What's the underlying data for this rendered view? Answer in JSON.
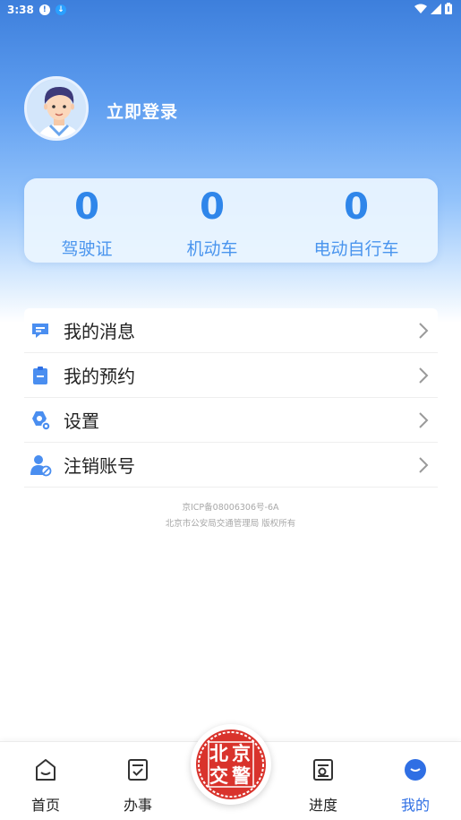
{
  "status_bar": {
    "time": "3:38",
    "left_icons": [
      "alert-circle-icon",
      "download-icon"
    ],
    "right_icons": [
      "wifi-icon",
      "signal-icon",
      "battery-icon"
    ]
  },
  "profile": {
    "login_label": "立即登录",
    "avatar_icon": "user-avatar-icon"
  },
  "stats": [
    {
      "value": "0",
      "label": "驾驶证"
    },
    {
      "value": "0",
      "label": "机动车"
    },
    {
      "value": "0",
      "label": "电动自行车"
    }
  ],
  "menu": [
    {
      "label": "我的消息",
      "icon": "message-icon"
    },
    {
      "label": "我的预约",
      "icon": "clipboard-icon"
    },
    {
      "label": "设置",
      "icon": "settings-icon"
    },
    {
      "label": "注销账号",
      "icon": "user-cancel-icon"
    }
  ],
  "footer": {
    "icp": "京ICP备08006306号-6A",
    "copyright": "北京市公安局交通管理局 版权所有"
  },
  "nav": {
    "home": "首页",
    "services": "办事",
    "center_seal": [
      "北",
      "京",
      "交",
      "警"
    ],
    "progress": "进度",
    "mine": "我的"
  },
  "colors": {
    "primary": "#2f6fe4",
    "stat_value": "#2f86ea",
    "seal": "#d9332c"
  }
}
